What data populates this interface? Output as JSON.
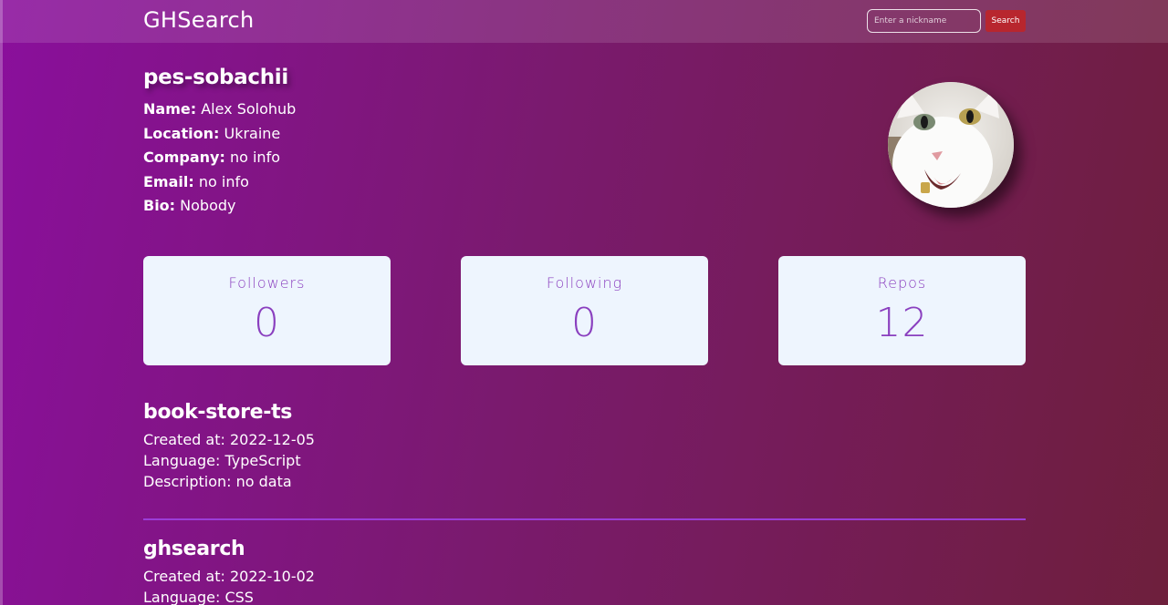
{
  "navbar": {
    "brand": "GHSearch",
    "search_placeholder": "Enter a nickname",
    "search_value": "",
    "search_button": "Search"
  },
  "profile": {
    "login": "pes-sobachii",
    "name_label": "Name:",
    "name": "Alex Solohub",
    "location_label": "Location:",
    "location": "Ukraine",
    "company_label": "Company:",
    "company": "no info",
    "email_label": "Email:",
    "email": "no info",
    "bio_label": "Bio:",
    "bio": "Nobody"
  },
  "stats": [
    {
      "label": "Followers",
      "value": "0"
    },
    {
      "label": "Following",
      "value": "0"
    },
    {
      "label": "Repos",
      "value": "12"
    }
  ],
  "repos": [
    {
      "name": "book-store-ts",
      "created": "Created at: 2022-12-05",
      "language": "Language: TypeScript",
      "description": "Description: no data"
    },
    {
      "name": "ghsearch",
      "created": "Created at: 2022-10-02",
      "language": "Language: CSS"
    }
  ],
  "colors": {
    "accent": "#8a3fbf",
    "button": "#b8262e",
    "card_bg": "#eef5fe",
    "divider": "#9b3dd8"
  }
}
